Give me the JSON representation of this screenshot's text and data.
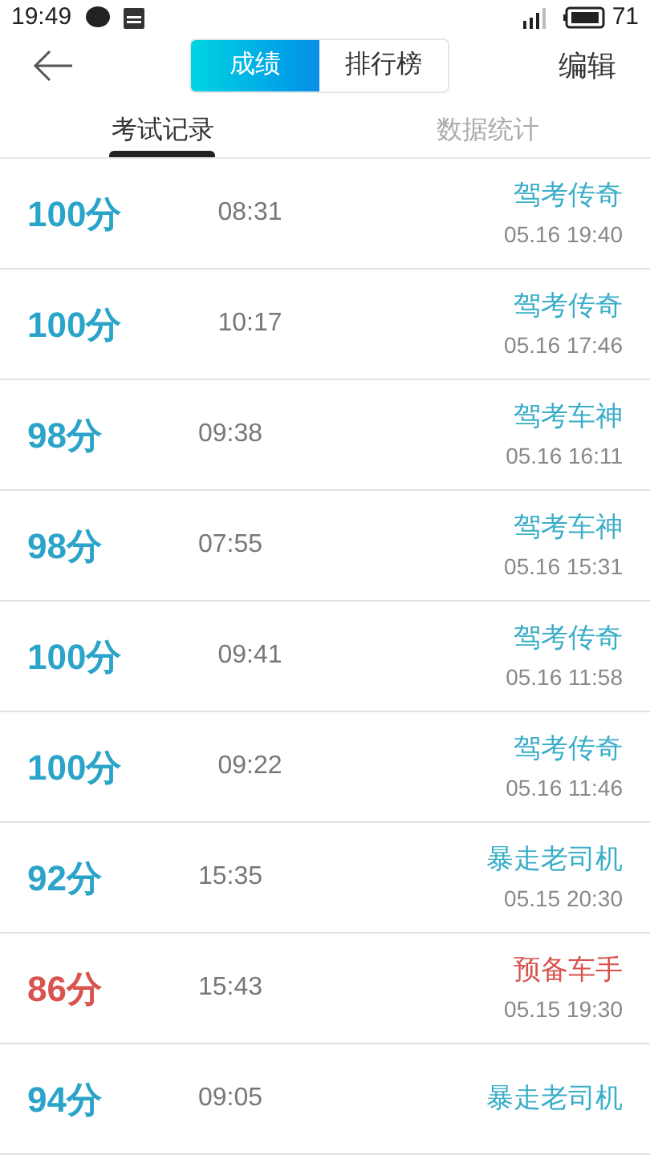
{
  "status_bar": {
    "time": "19:49",
    "battery": "71"
  },
  "nav": {
    "segments": [
      {
        "label": "成绩",
        "selected": true
      },
      {
        "label": "排行榜",
        "selected": false
      }
    ],
    "action": "编辑"
  },
  "tabs": [
    {
      "label": "考试记录",
      "selected": true
    },
    {
      "label": "数据统计",
      "selected": false
    }
  ],
  "records": [
    {
      "score": "100分",
      "duration": "08:31",
      "title": "驾考传奇",
      "date": "05.16 19:40",
      "kind": "pass"
    },
    {
      "score": "100分",
      "duration": "10:17",
      "title": "驾考传奇",
      "date": "05.16 17:46",
      "kind": "pass"
    },
    {
      "score": "98分",
      "duration": "09:38",
      "title": "驾考车神",
      "date": "05.16 16:11",
      "kind": "pass"
    },
    {
      "score": "98分",
      "duration": "07:55",
      "title": "驾考车神",
      "date": "05.16 15:31",
      "kind": "pass"
    },
    {
      "score": "100分",
      "duration": "09:41",
      "title": "驾考传奇",
      "date": "05.16 11:58",
      "kind": "pass"
    },
    {
      "score": "100分",
      "duration": "09:22",
      "title": "驾考传奇",
      "date": "05.16 11:46",
      "kind": "pass"
    },
    {
      "score": "92分",
      "duration": "15:35",
      "title": "暴走老司机",
      "date": "05.15 20:30",
      "kind": "pass"
    },
    {
      "score": "86分",
      "duration": "15:43",
      "title": "预备车手",
      "date": "05.15 19:30",
      "kind": "fail"
    },
    {
      "score": "94分",
      "duration": "09:05",
      "title": "暴走老司机",
      "kind": "pass"
    }
  ]
}
